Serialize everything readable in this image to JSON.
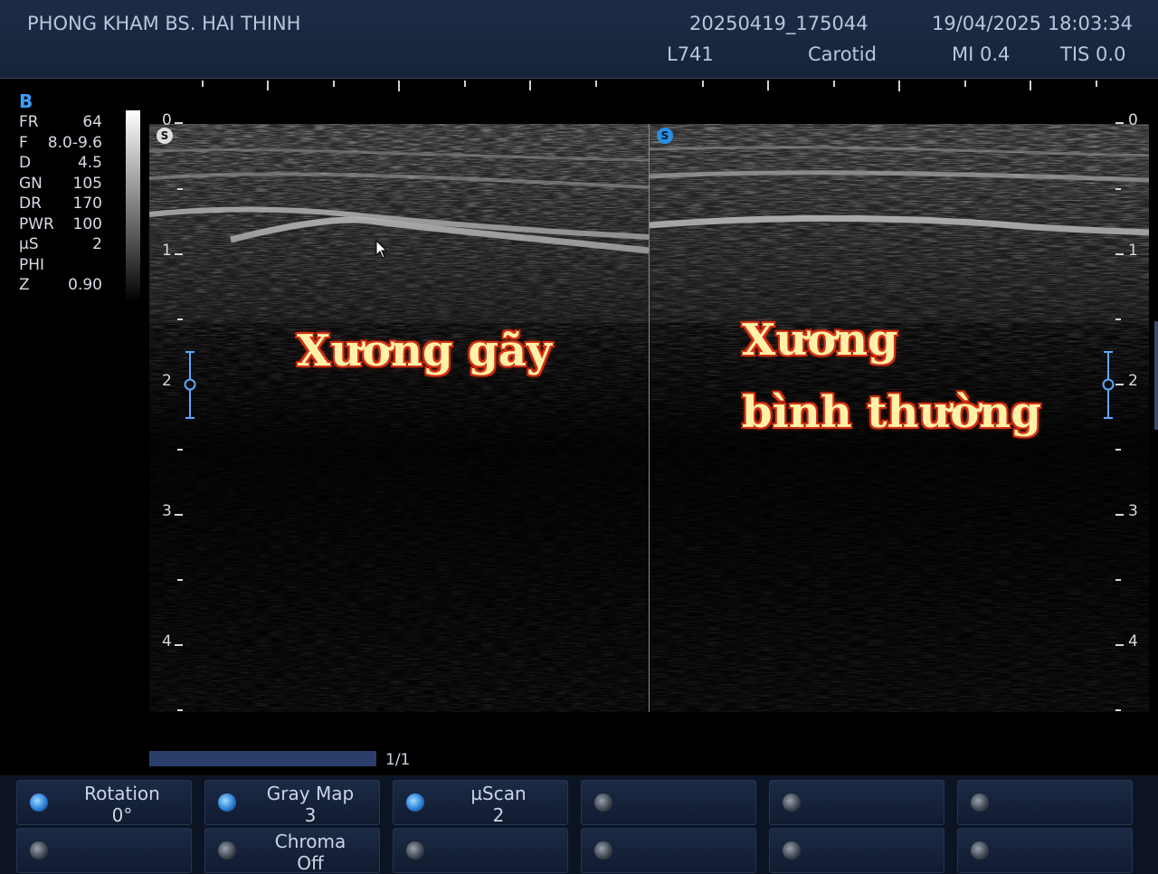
{
  "header": {
    "clinic": "PHONG KHAM BS. HAI THINH",
    "study_id": "20250419_175044",
    "datetime": "19/04/2025 18:03:34",
    "probe": "L741",
    "preset": "Carotid",
    "mi": "MI 0.4",
    "tis": "TIS 0.0"
  },
  "params": {
    "mode": "B",
    "rows": [
      {
        "label": "FR",
        "value": "64"
      },
      {
        "label": "F",
        "value": "8.0-9.6"
      },
      {
        "label": "D",
        "value": "4.5"
      },
      {
        "label": "GN",
        "value": "105"
      },
      {
        "label": "DR",
        "value": "170"
      },
      {
        "label": "PWR",
        "value": "100"
      },
      {
        "label": "µS",
        "value": "2"
      },
      {
        "label": "PHI",
        "value": ""
      },
      {
        "label": "Z",
        "value": "0.90"
      }
    ]
  },
  "image": {
    "left_badge": "S",
    "right_badge": "S",
    "left_annotation": "Xương gãy",
    "right_annotation_line1": "Xương",
    "right_annotation_line2": "bình thường",
    "depth_labels": [
      "0",
      "1",
      "2",
      "3",
      "4"
    ]
  },
  "page_indicator": "1/1",
  "softkeys": [
    {
      "line1": "Rotation",
      "line2": "0°",
      "active": true
    },
    {
      "line1": "Gray Map",
      "line2": "3",
      "active": true
    },
    {
      "line1": "µScan",
      "line2": "2",
      "active": true
    },
    {
      "line1": "",
      "line2": "",
      "active": false
    },
    {
      "line1": "",
      "line2": "",
      "active": false
    },
    {
      "line1": "",
      "line2": "",
      "active": false
    },
    {
      "line1": "",
      "line2": "",
      "active": false
    },
    {
      "line1": "Chroma",
      "line2": "Off",
      "active": false
    },
    {
      "line1": "",
      "line2": "",
      "active": false
    },
    {
      "line1": "",
      "line2": "",
      "active": false
    },
    {
      "line1": "",
      "line2": "",
      "active": false
    },
    {
      "line1": "",
      "line2": "",
      "active": false
    }
  ],
  "colors": {
    "header_bg": "#1d2c45",
    "accent_blue": "#3aa0ff",
    "annotation_fill": "#fff2a8",
    "annotation_outline": "#e23a1a"
  }
}
